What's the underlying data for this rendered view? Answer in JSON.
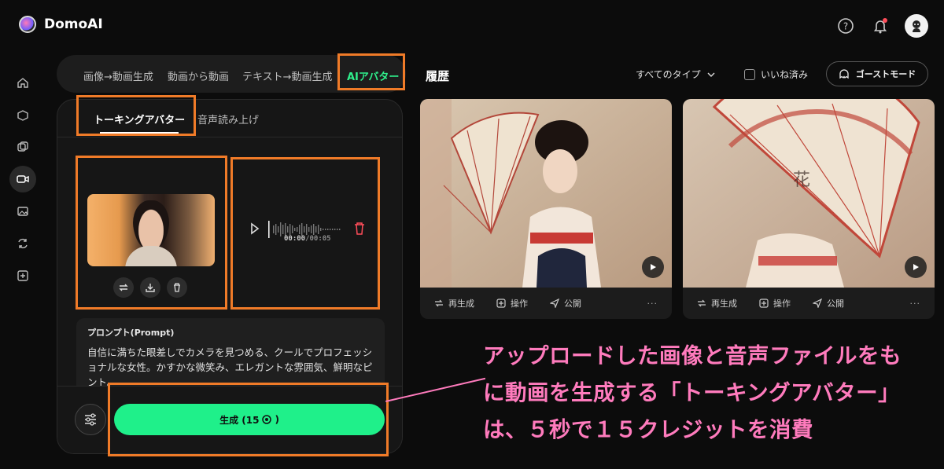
{
  "app": {
    "name": "DomoAI"
  },
  "header": {
    "icons": [
      "help-icon",
      "bell-icon",
      "avatar"
    ]
  },
  "sidebar": {
    "icons": [
      "home-icon",
      "box-icon",
      "layers-icon",
      "video-camera-icon",
      "image-icon",
      "refresh-icon",
      "add-square-icon"
    ]
  },
  "mode_tabs": [
    {
      "label": "画像→動画生成",
      "active": false
    },
    {
      "label": "動画から動画",
      "active": false
    },
    {
      "label": "テキスト→動画生成",
      "active": false
    },
    {
      "label": "AIアバター",
      "active": true
    }
  ],
  "sub_tabs": [
    {
      "label": "トーキングアバター",
      "active": true
    },
    {
      "label": "音声読み上げ",
      "active": false
    }
  ],
  "audio": {
    "current": "00:00",
    "total": "/00:05"
  },
  "prompt": {
    "label": "プロンプト(Prompt)",
    "text": "自信に満ちた眼差しでカメラを見つめる、クールでプロフェッショナルな女性。かすかな微笑み、エレガントな雰囲気、鮮明なピント。"
  },
  "generate_button": {
    "label": "生成 (15",
    "suffix": ")"
  },
  "history": {
    "title": "履歴",
    "type_filter": "すべてのタイプ",
    "likes_label": "いいね済み",
    "ghost_mode": "ゴーストモード",
    "cards": [
      {
        "actions": [
          "再生成",
          "操作",
          "公開"
        ]
      },
      {
        "actions": [
          "再生成",
          "操作",
          "公開"
        ]
      }
    ]
  },
  "annotation": {
    "line1": "アップロードした画像と音声ファイルをも",
    "line2": "に動画を生成する「トーキングアバター」",
    "line3": "は、５秒で１５クレジットを消費"
  },
  "colors": {
    "accent": "#1ff08a",
    "highlight": "#f07b28",
    "annotation": "#ff7bbd"
  }
}
